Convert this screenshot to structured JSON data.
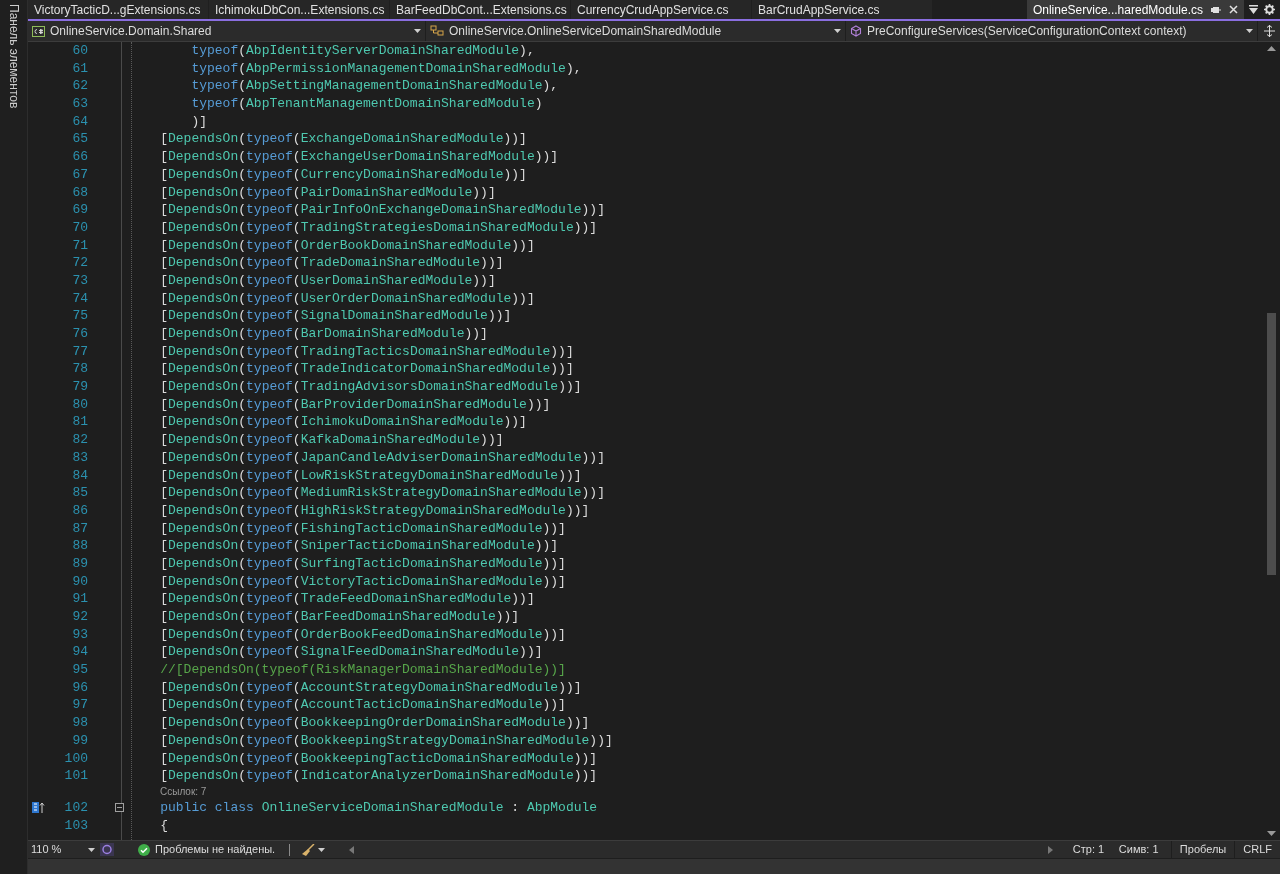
{
  "side_panel": {
    "label": "Панель элементов"
  },
  "tabs": [
    {
      "label": "VictoryTacticD...gExtensions.cs",
      "selected": false
    },
    {
      "label": "IchimokuDbCon...Extensions.cs",
      "selected": false
    },
    {
      "label": "BarFeedDbCont...Extensions.cs",
      "selected": false
    },
    {
      "label": "CurrencyCrudAppService.cs",
      "selected": false
    },
    {
      "label": "BarCrudAppService.cs",
      "selected": false
    },
    {
      "label": "OnlineService...haredModule.cs",
      "selected": true
    }
  ],
  "navigation": {
    "project": "OnlineService.Domain.Shared",
    "type": "OnlineService.OnlineServiceDomainSharedModule",
    "member": "PreConfigureServices(ServiceConfigurationContext context)"
  },
  "lines": [
    {
      "kind": "code",
      "number": "60",
      "tokens": [
        {
          "keyword": "        typeof"
        },
        {
          "punct": "("
        },
        {
          "type": "AbpIdentityServerDomainSharedModule"
        },
        {
          "punct": "),"
        }
      ]
    },
    {
      "kind": "code",
      "number": "61",
      "tokens": [
        {
          "keyword": "        typeof"
        },
        {
          "punct": "("
        },
        {
          "type": "AbpPermissionManagementDomainSharedModule"
        },
        {
          "punct": "),"
        }
      ]
    },
    {
      "kind": "code",
      "number": "62",
      "tokens": [
        {
          "keyword": "        typeof"
        },
        {
          "punct": "("
        },
        {
          "type": "AbpSettingManagementDomainSharedModule"
        },
        {
          "punct": "),"
        }
      ]
    },
    {
      "kind": "code",
      "number": "63",
      "tokens": [
        {
          "keyword": "        typeof"
        },
        {
          "punct": "("
        },
        {
          "type": "AbpTenantManagementDomainSharedModule"
        },
        {
          "punct": ")"
        }
      ]
    },
    {
      "kind": "code",
      "number": "64",
      "tokens": [
        {
          "punct": "        )]"
        }
      ]
    },
    {
      "kind": "code",
      "number": "65",
      "tokens": [
        {
          "punct": "    ["
        },
        {
          "type": "DependsOn"
        },
        {
          "punct": "("
        },
        {
          "keyword": "typeof"
        },
        {
          "punct": "("
        },
        {
          "type": "ExchangeDomainSharedModule"
        },
        {
          "punct": "))]"
        }
      ]
    },
    {
      "kind": "code",
      "number": "66",
      "tokens": [
        {
          "punct": "    ["
        },
        {
          "type": "DependsOn"
        },
        {
          "punct": "("
        },
        {
          "keyword": "typeof"
        },
        {
          "punct": "("
        },
        {
          "type": "ExchangeUserDomainSharedModule"
        },
        {
          "punct": "))]"
        }
      ]
    },
    {
      "kind": "code",
      "number": "67",
      "tokens": [
        {
          "punct": "    ["
        },
        {
          "type": "DependsOn"
        },
        {
          "punct": "("
        },
        {
          "keyword": "typeof"
        },
        {
          "punct": "("
        },
        {
          "type": "CurrencyDomainSharedModule"
        },
        {
          "punct": "))]"
        }
      ]
    },
    {
      "kind": "code",
      "number": "68",
      "tokens": [
        {
          "punct": "    ["
        },
        {
          "type": "DependsOn"
        },
        {
          "punct": "("
        },
        {
          "keyword": "typeof"
        },
        {
          "punct": "("
        },
        {
          "type": "PairDomainSharedModule"
        },
        {
          "punct": "))]"
        }
      ]
    },
    {
      "kind": "code",
      "number": "69",
      "tokens": [
        {
          "punct": "    ["
        },
        {
          "type": "DependsOn"
        },
        {
          "punct": "("
        },
        {
          "keyword": "typeof"
        },
        {
          "punct": "("
        },
        {
          "type": "PairInfoOnExchangeDomainSharedModule"
        },
        {
          "punct": "))]"
        }
      ]
    },
    {
      "kind": "code",
      "number": "70",
      "tokens": [
        {
          "punct": "    ["
        },
        {
          "type": "DependsOn"
        },
        {
          "punct": "("
        },
        {
          "keyword": "typeof"
        },
        {
          "punct": "("
        },
        {
          "type": "TradingStrategiesDomainSharedModule"
        },
        {
          "punct": "))]"
        }
      ]
    },
    {
      "kind": "code",
      "number": "71",
      "tokens": [
        {
          "punct": "    ["
        },
        {
          "type": "DependsOn"
        },
        {
          "punct": "("
        },
        {
          "keyword": "typeof"
        },
        {
          "punct": "("
        },
        {
          "type": "OrderBookDomainSharedModule"
        },
        {
          "punct": "))]"
        }
      ]
    },
    {
      "kind": "code",
      "number": "72",
      "tokens": [
        {
          "punct": "    ["
        },
        {
          "type": "DependsOn"
        },
        {
          "punct": "("
        },
        {
          "keyword": "typeof"
        },
        {
          "punct": "("
        },
        {
          "type": "TradeDomainSharedModule"
        },
        {
          "punct": "))]"
        }
      ]
    },
    {
      "kind": "code",
      "number": "73",
      "tokens": [
        {
          "punct": "    ["
        },
        {
          "type": "DependsOn"
        },
        {
          "punct": "("
        },
        {
          "keyword": "typeof"
        },
        {
          "punct": "("
        },
        {
          "type": "UserDomainSharedModule"
        },
        {
          "punct": "))]"
        }
      ]
    },
    {
      "kind": "code",
      "number": "74",
      "tokens": [
        {
          "punct": "    ["
        },
        {
          "type": "DependsOn"
        },
        {
          "punct": "("
        },
        {
          "keyword": "typeof"
        },
        {
          "punct": "("
        },
        {
          "type": "UserOrderDomainSharedModule"
        },
        {
          "punct": "))]"
        }
      ]
    },
    {
      "kind": "code",
      "number": "75",
      "tokens": [
        {
          "punct": "    ["
        },
        {
          "type": "DependsOn"
        },
        {
          "punct": "("
        },
        {
          "keyword": "typeof"
        },
        {
          "punct": "("
        },
        {
          "type": "SignalDomainSharedModule"
        },
        {
          "punct": "))]"
        }
      ]
    },
    {
      "kind": "code",
      "number": "76",
      "tokens": [
        {
          "punct": "    ["
        },
        {
          "type": "DependsOn"
        },
        {
          "punct": "("
        },
        {
          "keyword": "typeof"
        },
        {
          "punct": "("
        },
        {
          "type": "BarDomainSharedModule"
        },
        {
          "punct": "))]"
        }
      ]
    },
    {
      "kind": "code",
      "number": "77",
      "tokens": [
        {
          "punct": "    ["
        },
        {
          "type": "DependsOn"
        },
        {
          "punct": "("
        },
        {
          "keyword": "typeof"
        },
        {
          "punct": "("
        },
        {
          "type": "TradingTacticsDomainSharedModule"
        },
        {
          "punct": "))]"
        }
      ]
    },
    {
      "kind": "code",
      "number": "78",
      "tokens": [
        {
          "punct": "    ["
        },
        {
          "type": "DependsOn"
        },
        {
          "punct": "("
        },
        {
          "keyword": "typeof"
        },
        {
          "punct": "("
        },
        {
          "type": "TradeIndicatorDomainSharedModule"
        },
        {
          "punct": "))]"
        }
      ]
    },
    {
      "kind": "code",
      "number": "79",
      "tokens": [
        {
          "punct": "    ["
        },
        {
          "type": "DependsOn"
        },
        {
          "punct": "("
        },
        {
          "keyword": "typeof"
        },
        {
          "punct": "("
        },
        {
          "type": "TradingAdvisorsDomainSharedModule"
        },
        {
          "punct": "))]"
        }
      ]
    },
    {
      "kind": "code",
      "number": "80",
      "tokens": [
        {
          "punct": "    ["
        },
        {
          "type": "DependsOn"
        },
        {
          "punct": "("
        },
        {
          "keyword": "typeof"
        },
        {
          "punct": "("
        },
        {
          "type": "BarProviderDomainSharedModule"
        },
        {
          "punct": "))]"
        }
      ]
    },
    {
      "kind": "code",
      "number": "81",
      "tokens": [
        {
          "punct": "    ["
        },
        {
          "type": "DependsOn"
        },
        {
          "punct": "("
        },
        {
          "keyword": "typeof"
        },
        {
          "punct": "("
        },
        {
          "type": "IchimokuDomainSharedModule"
        },
        {
          "punct": "))]"
        }
      ]
    },
    {
      "kind": "code",
      "number": "82",
      "tokens": [
        {
          "punct": "    ["
        },
        {
          "type": "DependsOn"
        },
        {
          "punct": "("
        },
        {
          "keyword": "typeof"
        },
        {
          "punct": "("
        },
        {
          "type": "KafkaDomainSharedModule"
        },
        {
          "punct": "))]"
        }
      ]
    },
    {
      "kind": "code",
      "number": "83",
      "tokens": [
        {
          "punct": "    ["
        },
        {
          "type": "DependsOn"
        },
        {
          "punct": "("
        },
        {
          "keyword": "typeof"
        },
        {
          "punct": "("
        },
        {
          "type": "JapanCandleAdviserDomainSharedModule"
        },
        {
          "punct": "))]"
        }
      ]
    },
    {
      "kind": "code",
      "number": "84",
      "tokens": [
        {
          "punct": "    ["
        },
        {
          "type": "DependsOn"
        },
        {
          "punct": "("
        },
        {
          "keyword": "typeof"
        },
        {
          "punct": "("
        },
        {
          "type": "LowRiskStrategyDomainSharedModule"
        },
        {
          "punct": "))]"
        }
      ]
    },
    {
      "kind": "code",
      "number": "85",
      "tokens": [
        {
          "punct": "    ["
        },
        {
          "type": "DependsOn"
        },
        {
          "punct": "("
        },
        {
          "keyword": "typeof"
        },
        {
          "punct": "("
        },
        {
          "type": "MediumRiskStrategyDomainSharedModule"
        },
        {
          "punct": "))]"
        }
      ]
    },
    {
      "kind": "code",
      "number": "86",
      "tokens": [
        {
          "punct": "    ["
        },
        {
          "type": "DependsOn"
        },
        {
          "punct": "("
        },
        {
          "keyword": "typeof"
        },
        {
          "punct": "("
        },
        {
          "type": "HighRiskStrategyDomainSharedModule"
        },
        {
          "punct": "))]"
        }
      ]
    },
    {
      "kind": "code",
      "number": "87",
      "tokens": [
        {
          "punct": "    ["
        },
        {
          "type": "DependsOn"
        },
        {
          "punct": "("
        },
        {
          "keyword": "typeof"
        },
        {
          "punct": "("
        },
        {
          "type": "FishingTacticDomainSharedModule"
        },
        {
          "punct": "))]"
        }
      ]
    },
    {
      "kind": "code",
      "number": "88",
      "tokens": [
        {
          "punct": "    ["
        },
        {
          "type": "DependsOn"
        },
        {
          "punct": "("
        },
        {
          "keyword": "typeof"
        },
        {
          "punct": "("
        },
        {
          "type": "SniperTacticDomainSharedModule"
        },
        {
          "punct": "))]"
        }
      ]
    },
    {
      "kind": "code",
      "number": "89",
      "tokens": [
        {
          "punct": "    ["
        },
        {
          "type": "DependsOn"
        },
        {
          "punct": "("
        },
        {
          "keyword": "typeof"
        },
        {
          "punct": "("
        },
        {
          "type": "SurfingTacticDomainSharedModule"
        },
        {
          "punct": "))]"
        }
      ]
    },
    {
      "kind": "code",
      "number": "90",
      "tokens": [
        {
          "punct": "    ["
        },
        {
          "type": "DependsOn"
        },
        {
          "punct": "("
        },
        {
          "keyword": "typeof"
        },
        {
          "punct": "("
        },
        {
          "type": "VictoryTacticDomainSharedModule"
        },
        {
          "punct": "))]"
        }
      ]
    },
    {
      "kind": "code",
      "number": "91",
      "tokens": [
        {
          "punct": "    ["
        },
        {
          "type": "DependsOn"
        },
        {
          "punct": "("
        },
        {
          "keyword": "typeof"
        },
        {
          "punct": "("
        },
        {
          "type": "TradeFeedDomainSharedModule"
        },
        {
          "punct": "))]"
        }
      ]
    },
    {
      "kind": "code",
      "number": "92",
      "tokens": [
        {
          "punct": "    ["
        },
        {
          "type": "DependsOn"
        },
        {
          "punct": "("
        },
        {
          "keyword": "typeof"
        },
        {
          "punct": "("
        },
        {
          "type": "BarFeedDomainSharedModule"
        },
        {
          "punct": "))]"
        }
      ]
    },
    {
      "kind": "code",
      "number": "93",
      "tokens": [
        {
          "punct": "    ["
        },
        {
          "type": "DependsOn"
        },
        {
          "punct": "("
        },
        {
          "keyword": "typeof"
        },
        {
          "punct": "("
        },
        {
          "type": "OrderBookFeedDomainSharedModule"
        },
        {
          "punct": "))]"
        }
      ]
    },
    {
      "kind": "code",
      "number": "94",
      "tokens": [
        {
          "punct": "    ["
        },
        {
          "type": "DependsOn"
        },
        {
          "punct": "("
        },
        {
          "keyword": "typeof"
        },
        {
          "punct": "("
        },
        {
          "type": "SignalFeedDomainSharedModule"
        },
        {
          "punct": "))]"
        }
      ]
    },
    {
      "kind": "code",
      "number": "95",
      "tokens": [
        {
          "comment": "    //[DependsOn(typeof(RiskManagerDomainSharedModule))]"
        }
      ]
    },
    {
      "kind": "code",
      "number": "96",
      "tokens": [
        {
          "punct": "    ["
        },
        {
          "type": "DependsOn"
        },
        {
          "punct": "("
        },
        {
          "keyword": "typeof"
        },
        {
          "punct": "("
        },
        {
          "type": "AccountStrategyDomainSharedModule"
        },
        {
          "punct": "))]"
        }
      ]
    },
    {
      "kind": "code",
      "number": "97",
      "tokens": [
        {
          "punct": "    ["
        },
        {
          "type": "DependsOn"
        },
        {
          "punct": "("
        },
        {
          "keyword": "typeof"
        },
        {
          "punct": "("
        },
        {
          "type": "AccountTacticDomainSharedModule"
        },
        {
          "punct": "))]"
        }
      ]
    },
    {
      "kind": "code",
      "number": "98",
      "tokens": [
        {
          "punct": "    ["
        },
        {
          "type": "DependsOn"
        },
        {
          "punct": "("
        },
        {
          "keyword": "typeof"
        },
        {
          "punct": "("
        },
        {
          "type": "BookkeepingOrderDomainSharedModule"
        },
        {
          "punct": "))]"
        }
      ]
    },
    {
      "kind": "code",
      "number": "99",
      "tokens": [
        {
          "punct": "    ["
        },
        {
          "type": "DependsOn"
        },
        {
          "punct": "("
        },
        {
          "keyword": "typeof"
        },
        {
          "punct": "("
        },
        {
          "type": "BookkeepingStrategyDomainSharedModule"
        },
        {
          "punct": "))]"
        }
      ]
    },
    {
      "kind": "code",
      "number": "100",
      "tokens": [
        {
          "punct": "    ["
        },
        {
          "type": "DependsOn"
        },
        {
          "punct": "("
        },
        {
          "keyword": "typeof"
        },
        {
          "punct": "("
        },
        {
          "type": "BookkeepingTacticDomainSharedModule"
        },
        {
          "punct": "))]"
        }
      ]
    },
    {
      "kind": "code",
      "number": "101",
      "tokens": [
        {
          "punct": "    ["
        },
        {
          "type": "DependsOn"
        },
        {
          "punct": "("
        },
        {
          "keyword": "typeof"
        },
        {
          "punct": "("
        },
        {
          "type": "IndicatorAnalyzerDomainSharedModule"
        },
        {
          "punct": "))]"
        }
      ]
    },
    {
      "kind": "codelens",
      "text": "Ссылок: 7"
    },
    {
      "kind": "code",
      "number": "102",
      "gutter_marker": true,
      "foldable": true,
      "tokens": [
        {
          "keyword": "    public class "
        },
        {
          "type": "OnlineServiceDomainSharedModule"
        },
        {
          "punct": " : "
        },
        {
          "type": "AbpModule"
        }
      ]
    },
    {
      "kind": "code",
      "number": "103",
      "tokens": [
        {
          "punct": "    {"
        }
      ]
    }
  ],
  "status_bar": {
    "zoom": "110 %",
    "issues": "Проблемы не найдены.",
    "line": "Стр: 1",
    "column": "Симв: 1",
    "indent": "Пробелы",
    "line_ending": "CRLF"
  }
}
